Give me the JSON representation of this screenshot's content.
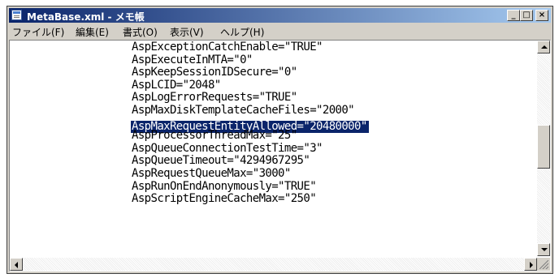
{
  "window": {
    "title": "MetaBase.xml - メモ帳",
    "buttons": {
      "minimize": "_",
      "maximize": "□",
      "close": "×"
    }
  },
  "menubar": {
    "items": [
      "ファイル(F)",
      "編集(E)",
      "書式(O)",
      "表示(V)",
      "ヘルプ(H)"
    ]
  },
  "editor": {
    "lines": [
      "AspExceptionCatchEnable=\"TRUE\"",
      "AspExecuteInMTA=\"0\"",
      "AspKeepSessionIDSecure=\"0\"",
      "AspLCID=\"2048\"",
      "AspLogErrorRequests=\"TRUE\"",
      "AspMaxDiskTemplateCacheFiles=\"2000\"",
      "AspMaxRequestEntityAllowed=\"20480000\"",
      "AspProcessorThreadMax=\"25\"",
      "AspQueueConnectionTestTime=\"3\"",
      "AspQueueTimeout=\"4294967295\"",
      "AspRequestQueueMax=\"3000\"",
      "AspRunOnEndAnonymously=\"TRUE\"",
      "AspScriptEngineCacheMax=\"250\""
    ],
    "selected_line": "AspMaxRequestEntityAllowed=\"20480000\""
  },
  "icons": [
    "notepad-icon",
    "minimize-icon",
    "maximize-icon",
    "close-icon",
    "scroll-up-icon",
    "scroll-down-icon",
    "scroll-left-icon",
    "scroll-right-icon",
    "size-grip-icon"
  ],
  "colors": {
    "titlebar": "#0a246a",
    "selection": "#0a246a",
    "chrome": "#d4d0c8"
  }
}
